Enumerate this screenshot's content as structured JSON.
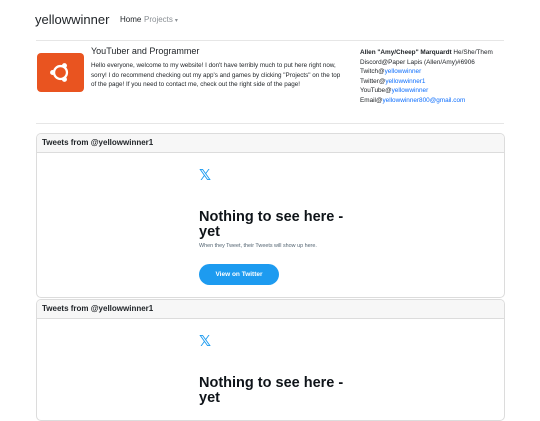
{
  "nav": {
    "brand": "yellowwinner",
    "home": "Home",
    "projects": "Projects",
    "projects_caret": "▾"
  },
  "intro": {
    "title": "YouTuber and Programmer",
    "text": "Hello everyone, welcome to my website! I don't have terribly much to put here right now, sorry! I do recommend checking out my app's and games by clicking \"Projects\" on the top of the page! If you need to contact me, check out the right side of the page!"
  },
  "profile": {
    "name": "Allen \"Amy/Cheep\" Marquardt",
    "pronouns": "He/She/Them",
    "discord_label": "Discord@",
    "discord_value": "Paper Lapis (Allen/Amy)#6906",
    "twitch_label": "Twitch@",
    "twitch_value": "yellowwinner",
    "twitter_label": "Twitter@",
    "twitter_value": "yellowwinner1",
    "youtube_label": "YouTube@",
    "youtube_value": "yellowwinner",
    "email_label": "Email@",
    "email_value": "yellowwinner800@gmail.com"
  },
  "colors": {
    "logo_bg": "#e95420",
    "link": "#0d6efd",
    "twitter_blue": "#1d9bf0"
  },
  "tweets": [
    {
      "header": "Tweets from @yellowwinner1",
      "icon": "x-logo-icon",
      "icon_glyph": "𝕏",
      "title": "Nothing to see here - yet",
      "subtitle": "When they Tweet, their Tweets will show up here.",
      "button": "View on Twitter"
    },
    {
      "header": "Tweets from @yellowwinner1",
      "icon": "x-logo-icon",
      "icon_glyph": "𝕏",
      "title": "Nothing to see here - yet"
    }
  ]
}
